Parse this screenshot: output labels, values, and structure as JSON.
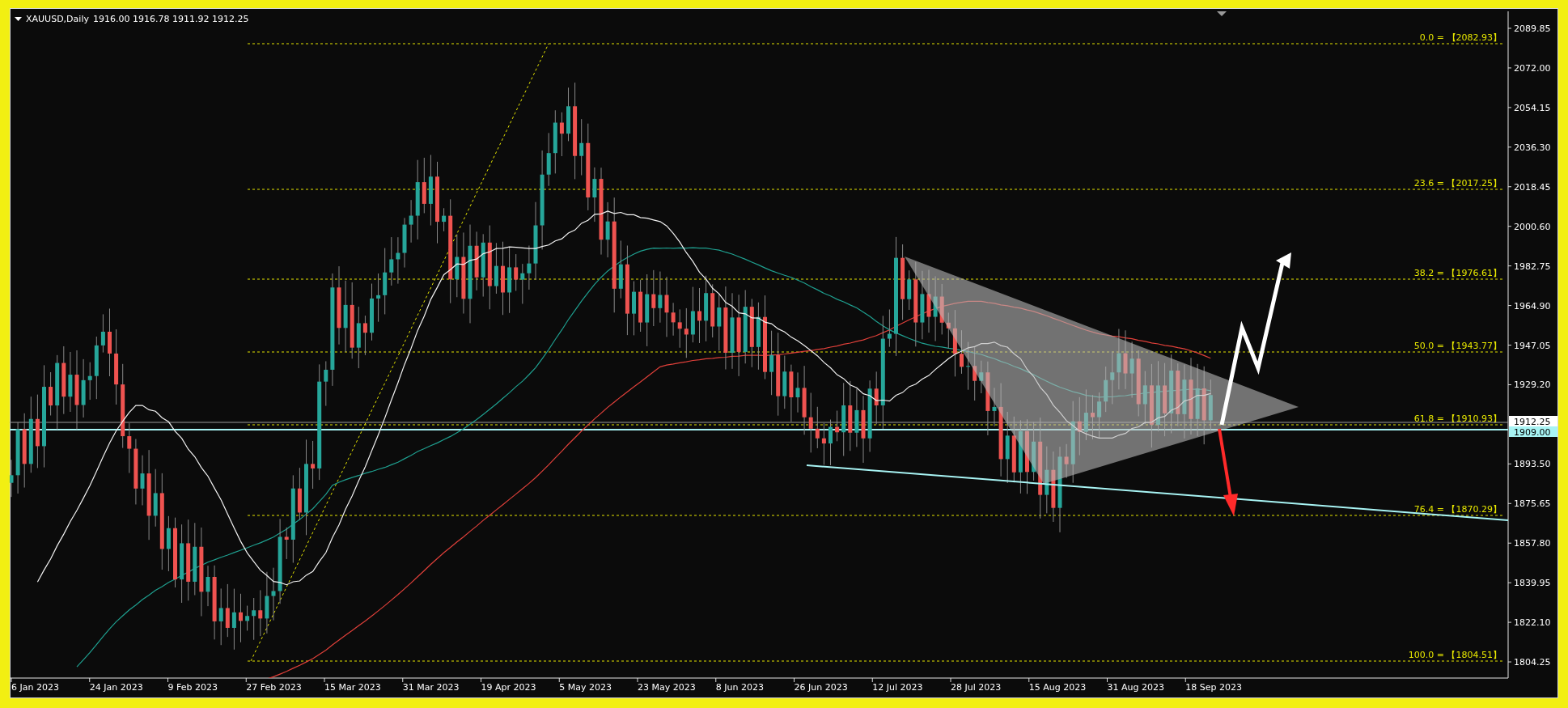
{
  "header": {
    "symbol": "XAUUSD,Daily",
    "ohlc": "1916.00 1916.78 1911.92 1912.25"
  },
  "price_axis": {
    "ticks": [
      "2089.85",
      "2072.00",
      "2054.15",
      "2036.30",
      "2018.45",
      "2000.60",
      "1982.75",
      "1964.90",
      "1947.05",
      "1929.20",
      "1893.50",
      "1875.65",
      "1857.80",
      "1839.95",
      "1822.10",
      "1804.25"
    ],
    "current_price": "1912.25",
    "line_price": "1909.00"
  },
  "time_axis": {
    "labels": [
      "6 Jan 2023",
      "24 Jan 2023",
      "9 Feb 2023",
      "27 Feb 2023",
      "15 Mar 2023",
      "31 Mar 2023",
      "19 Apr 2023",
      "5 May 2023",
      "23 May 2023",
      "8 Jun 2023",
      "26 Jun 2023",
      "12 Jul 2023",
      "28 Jul 2023",
      "15 Aug 2023",
      "31 Aug 2023",
      "18 Sep 2023"
    ]
  },
  "fibonacci": [
    {
      "label": "0.0 = 【2082.93】"
    },
    {
      "label": "23.6 = 【2017.25】"
    },
    {
      "label": "38.2 = 【1976.61】"
    },
    {
      "label": "50.0 = 【1943.77】"
    },
    {
      "label": "61.8 = 【1910.93】"
    },
    {
      "label": "76.4 = 【1870.29】"
    },
    {
      "label": "100.0 = 【1804.51】"
    }
  ]
}
